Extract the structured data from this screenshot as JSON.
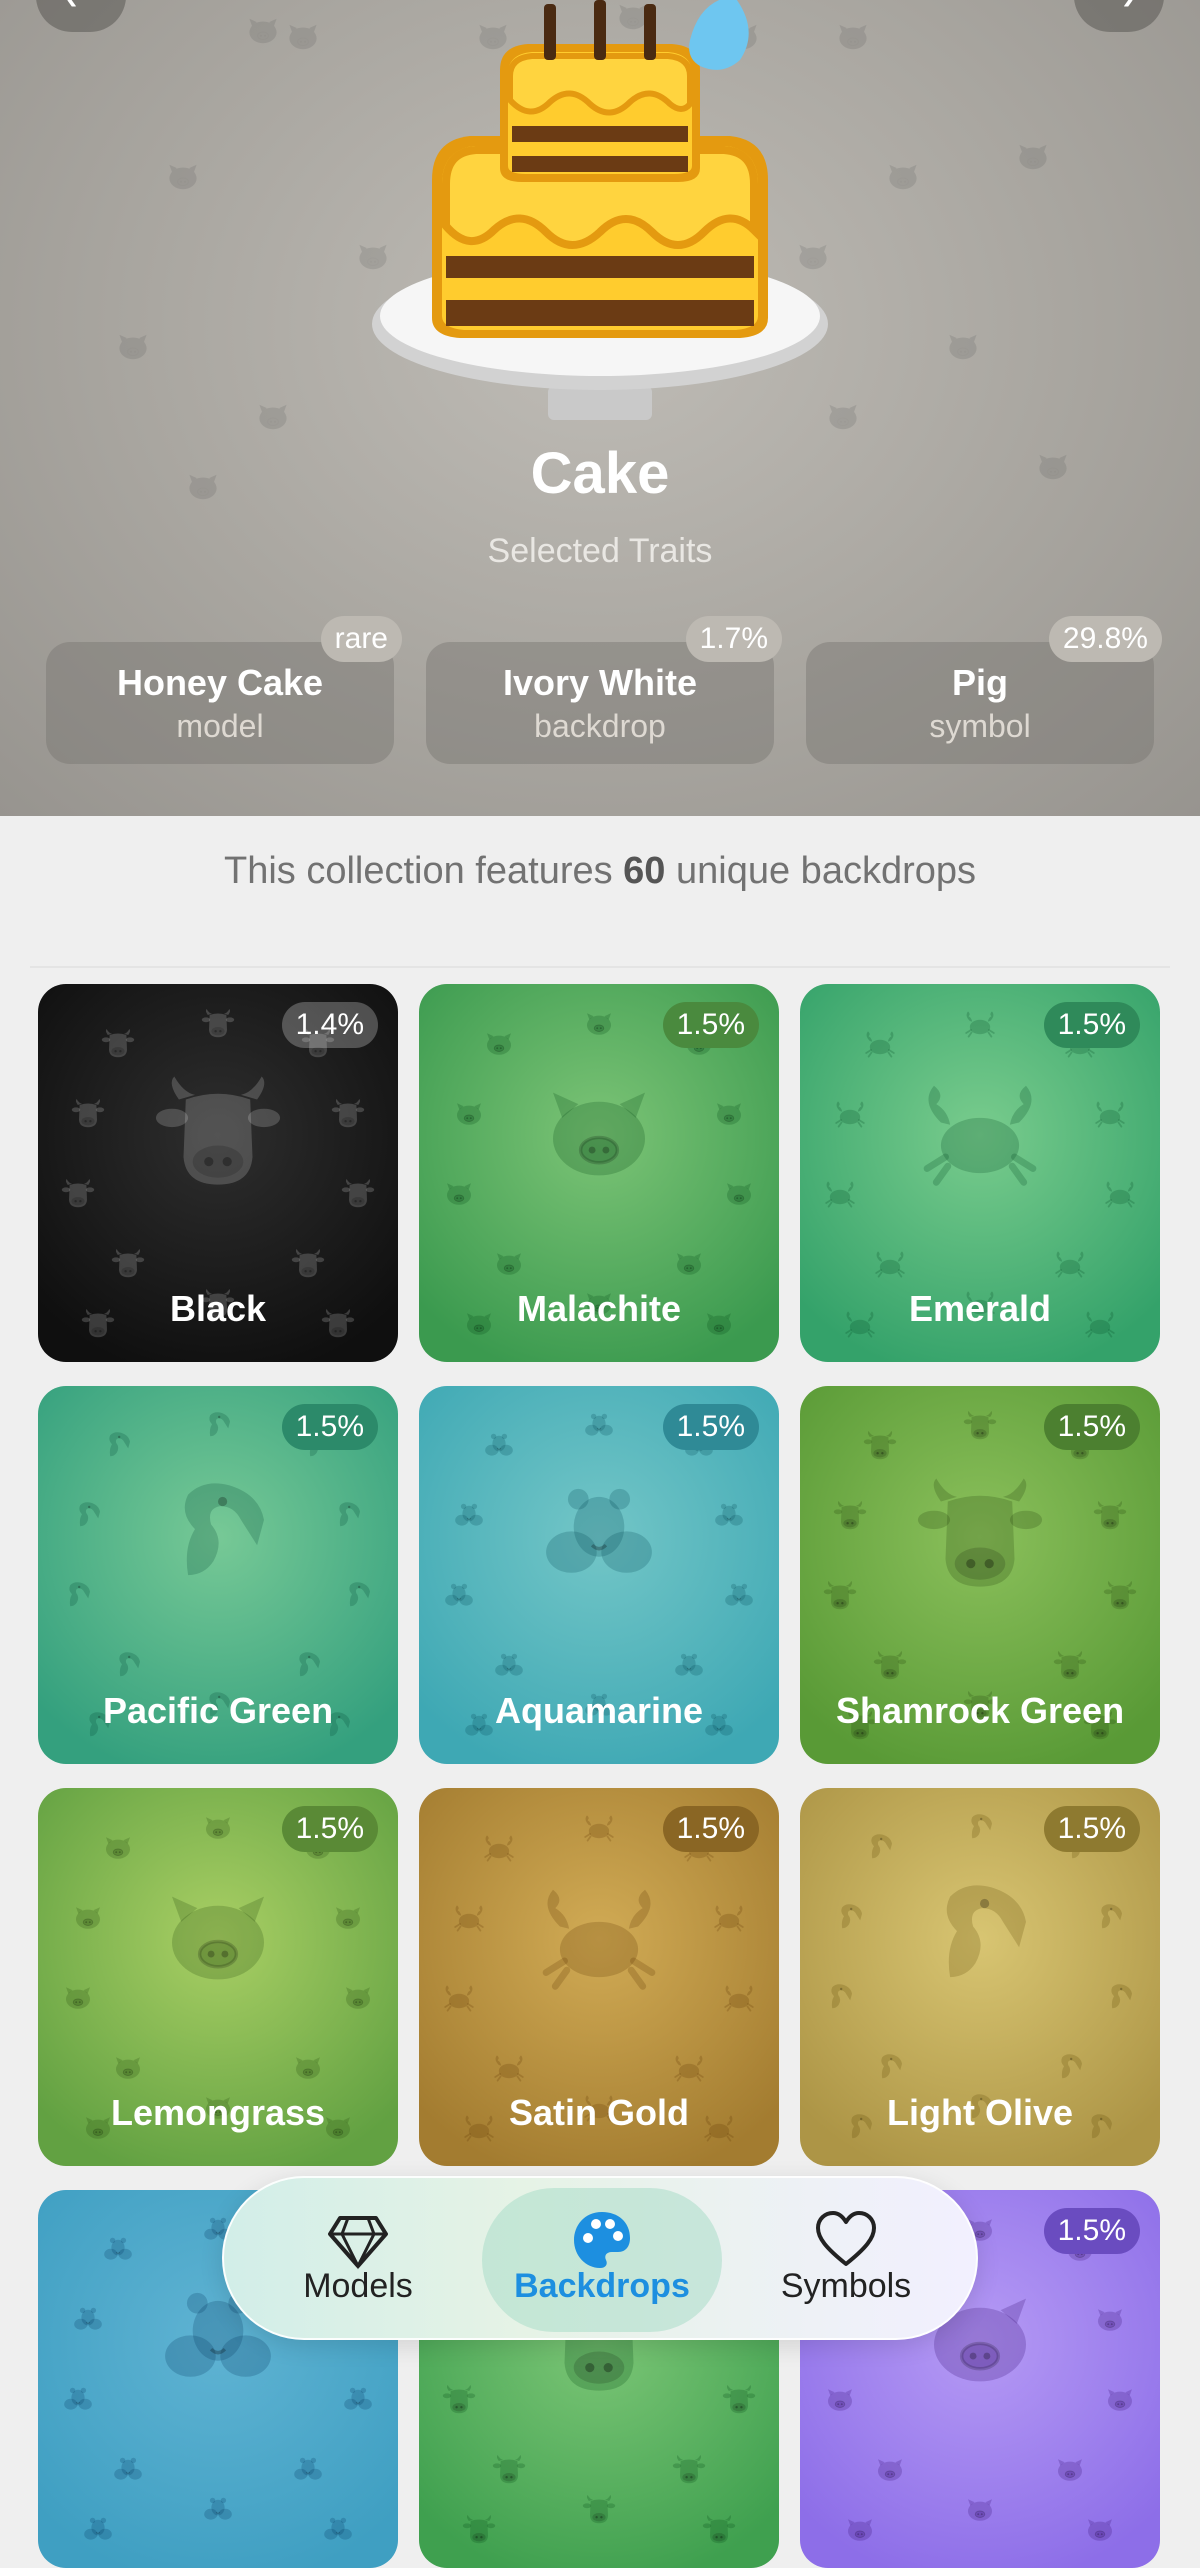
{
  "hero": {
    "title": "Cake",
    "subtitle": "Selected Traits",
    "traits": [
      {
        "name": "Honey Cake",
        "type": "model",
        "badge": "rare"
      },
      {
        "name": "Ivory White",
        "type": "backdrop",
        "badge": "1.7%"
      },
      {
        "name": "Pig",
        "type": "symbol",
        "badge": "29.8%"
      }
    ]
  },
  "info": {
    "prefix": "This collection features ",
    "count": "60",
    "suffix": " unique backdrops"
  },
  "tiles": [
    {
      "name": "Black",
      "pct": "1.4%",
      "icon": "cow-icon"
    },
    {
      "name": "Malachite",
      "pct": "1.5%",
      "icon": "pig-icon"
    },
    {
      "name": "Emerald",
      "pct": "1.5%",
      "icon": "crab-icon"
    },
    {
      "name": "Pacific Green",
      "pct": "1.5%",
      "icon": "flamingo-icon"
    },
    {
      "name": "Aquamarine",
      "pct": "1.5%",
      "icon": "hamster-icon"
    },
    {
      "name": "Shamrock Green",
      "pct": "1.5%",
      "icon": "cow-icon"
    },
    {
      "name": "Lemongrass",
      "pct": "1.5%",
      "icon": "pig-icon"
    },
    {
      "name": "Satin Gold",
      "pct": "1.5%",
      "icon": "crab-icon"
    },
    {
      "name": "Light Olive",
      "pct": "1.5%",
      "icon": "flamingo-icon"
    },
    {
      "name": "",
      "pct": "",
      "icon": "hamster-icon"
    },
    {
      "name": "",
      "pct": "",
      "icon": "cow-icon"
    },
    {
      "name": "",
      "pct": "1.5%",
      "icon": "pig-icon"
    }
  ],
  "nav": {
    "models": "Models",
    "backdrops": "Backdrops",
    "symbols": "Symbols"
  },
  "colors": {
    "accent": "#1d8fe0",
    "black": "#151515",
    "malachite": "#3fa45a",
    "emerald": "#3cab72",
    "pacific_green": "#39a582",
    "aquamarine": "#42aeb8",
    "shamrock_green": "#5f9e3f",
    "lemongrass": "#6aa647",
    "satin_gold": "#b08a3a",
    "light_olive": "#b19c4c"
  }
}
